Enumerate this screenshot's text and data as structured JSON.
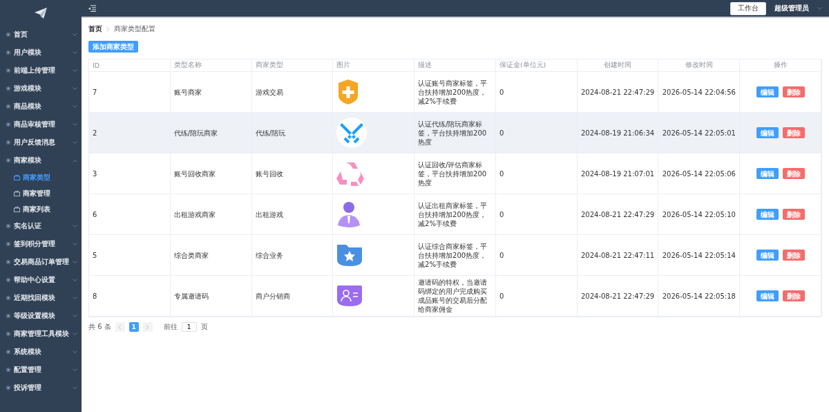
{
  "sidebar": {
    "items": [
      {
        "label": "首页",
        "expanded": false
      },
      {
        "label": "用户模块",
        "expanded": false
      },
      {
        "label": "前端上传管理",
        "expanded": false
      },
      {
        "label": "游戏模块",
        "expanded": false
      },
      {
        "label": "商品模块",
        "expanded": false
      },
      {
        "label": "商品审核管理",
        "expanded": false
      },
      {
        "label": "用户反馈消息",
        "expanded": false
      },
      {
        "label": "商家模块",
        "expanded": true,
        "children": [
          {
            "label": "商家类型",
            "selected": true
          },
          {
            "label": "商家管理",
            "selected": false
          },
          {
            "label": "商家列表",
            "selected": false
          }
        ]
      },
      {
        "label": "实名认证",
        "expanded": false
      },
      {
        "label": "签到积分管理",
        "expanded": false
      },
      {
        "label": "交易商品订单管理",
        "expanded": false
      },
      {
        "label": "帮助中心设置",
        "expanded": false
      },
      {
        "label": "近期找回模块",
        "expanded": false
      },
      {
        "label": "等级设置模块",
        "expanded": false
      },
      {
        "label": "商家管理工具模块",
        "expanded": false
      },
      {
        "label": "系统模块",
        "expanded": false
      },
      {
        "label": "配置管理",
        "expanded": false
      },
      {
        "label": "投诉管理",
        "expanded": false
      }
    ]
  },
  "header": {
    "workbench_button": "工作台",
    "user": "超级管理员"
  },
  "breadcrumb": [
    "首页",
    "商家类型配置"
  ],
  "add_button": "添加商家类型",
  "table": {
    "columns": [
      "ID",
      "类型名称",
      "商家类型",
      "图片",
      "描述",
      "保证金(单位元)",
      "创建时间",
      "修改时间",
      "操作"
    ],
    "rows": [
      {
        "id": "7",
        "name": "账号商家",
        "type": "游戏交易",
        "description": "认证账号商家标签，平台扶持增加200热度，减2%手续费",
        "deposit": "0",
        "created": "2024-08-21 22:47:29",
        "modified": "2026-05-14 22:04:56",
        "hovered": false
      },
      {
        "id": "2",
        "name": "代练/陪玩商家",
        "type": "代练/陪玩",
        "description": "认证代练/陪玩商家标签，平台扶持增加200热度",
        "deposit": "0",
        "created": "2024-08-19 21:06:34",
        "modified": "2026-05-14 22:05:01",
        "hovered": true
      },
      {
        "id": "3",
        "name": "账号回收商家",
        "type": "账号回收",
        "description": "认证回收/评估商家标签，平台扶持增加200热度",
        "deposit": "0",
        "created": "2024-08-19 21:07:01",
        "modified": "2026-05-14 22:05:06",
        "hovered": false
      },
      {
        "id": "6",
        "name": "出租游戏商家",
        "type": "出租游戏",
        "description": "认证出租商家标签，平台扶持增加200热度，减2%手续费",
        "deposit": "0",
        "created": "2024-08-21 22:47:29",
        "modified": "2026-05-14 22:05:10",
        "hovered": false
      },
      {
        "id": "5",
        "name": "综合类商家",
        "type": "综合业务",
        "description": "认证综合商家标签，平台扶持增加200热度，减2%手续费",
        "deposit": "0",
        "created": "2024-08-21 22:47:11",
        "modified": "2026-05-14 22:05:14",
        "hovered": false
      },
      {
        "id": "8",
        "name": "专属邀请码",
        "type": "商户分销商",
        "description": "邀请码的特权，当邀请码绑定的用户完成购买成品账号的交易后分配给商家佣金",
        "deposit": "0",
        "created": "2024-08-21 22:47:29",
        "modified": "2026-05-14 22:05:18",
        "hovered": false
      }
    ],
    "actions": [
      [
        "编辑",
        "删除"
      ],
      [
        "编辑",
        "删除"
      ],
      [
        "编辑",
        "删除"
      ],
      [
        "编辑",
        "删除"
      ],
      [
        "编辑",
        "删除"
      ],
      [
        "编辑",
        "删除"
      ]
    ]
  },
  "pagination": {
    "total": "共 6 条",
    "pages": [
      {
        "label": "1",
        "selected": true
      }
    ],
    "goto_label": "前往",
    "goto_value": "1",
    "page_unit": "页"
  }
}
